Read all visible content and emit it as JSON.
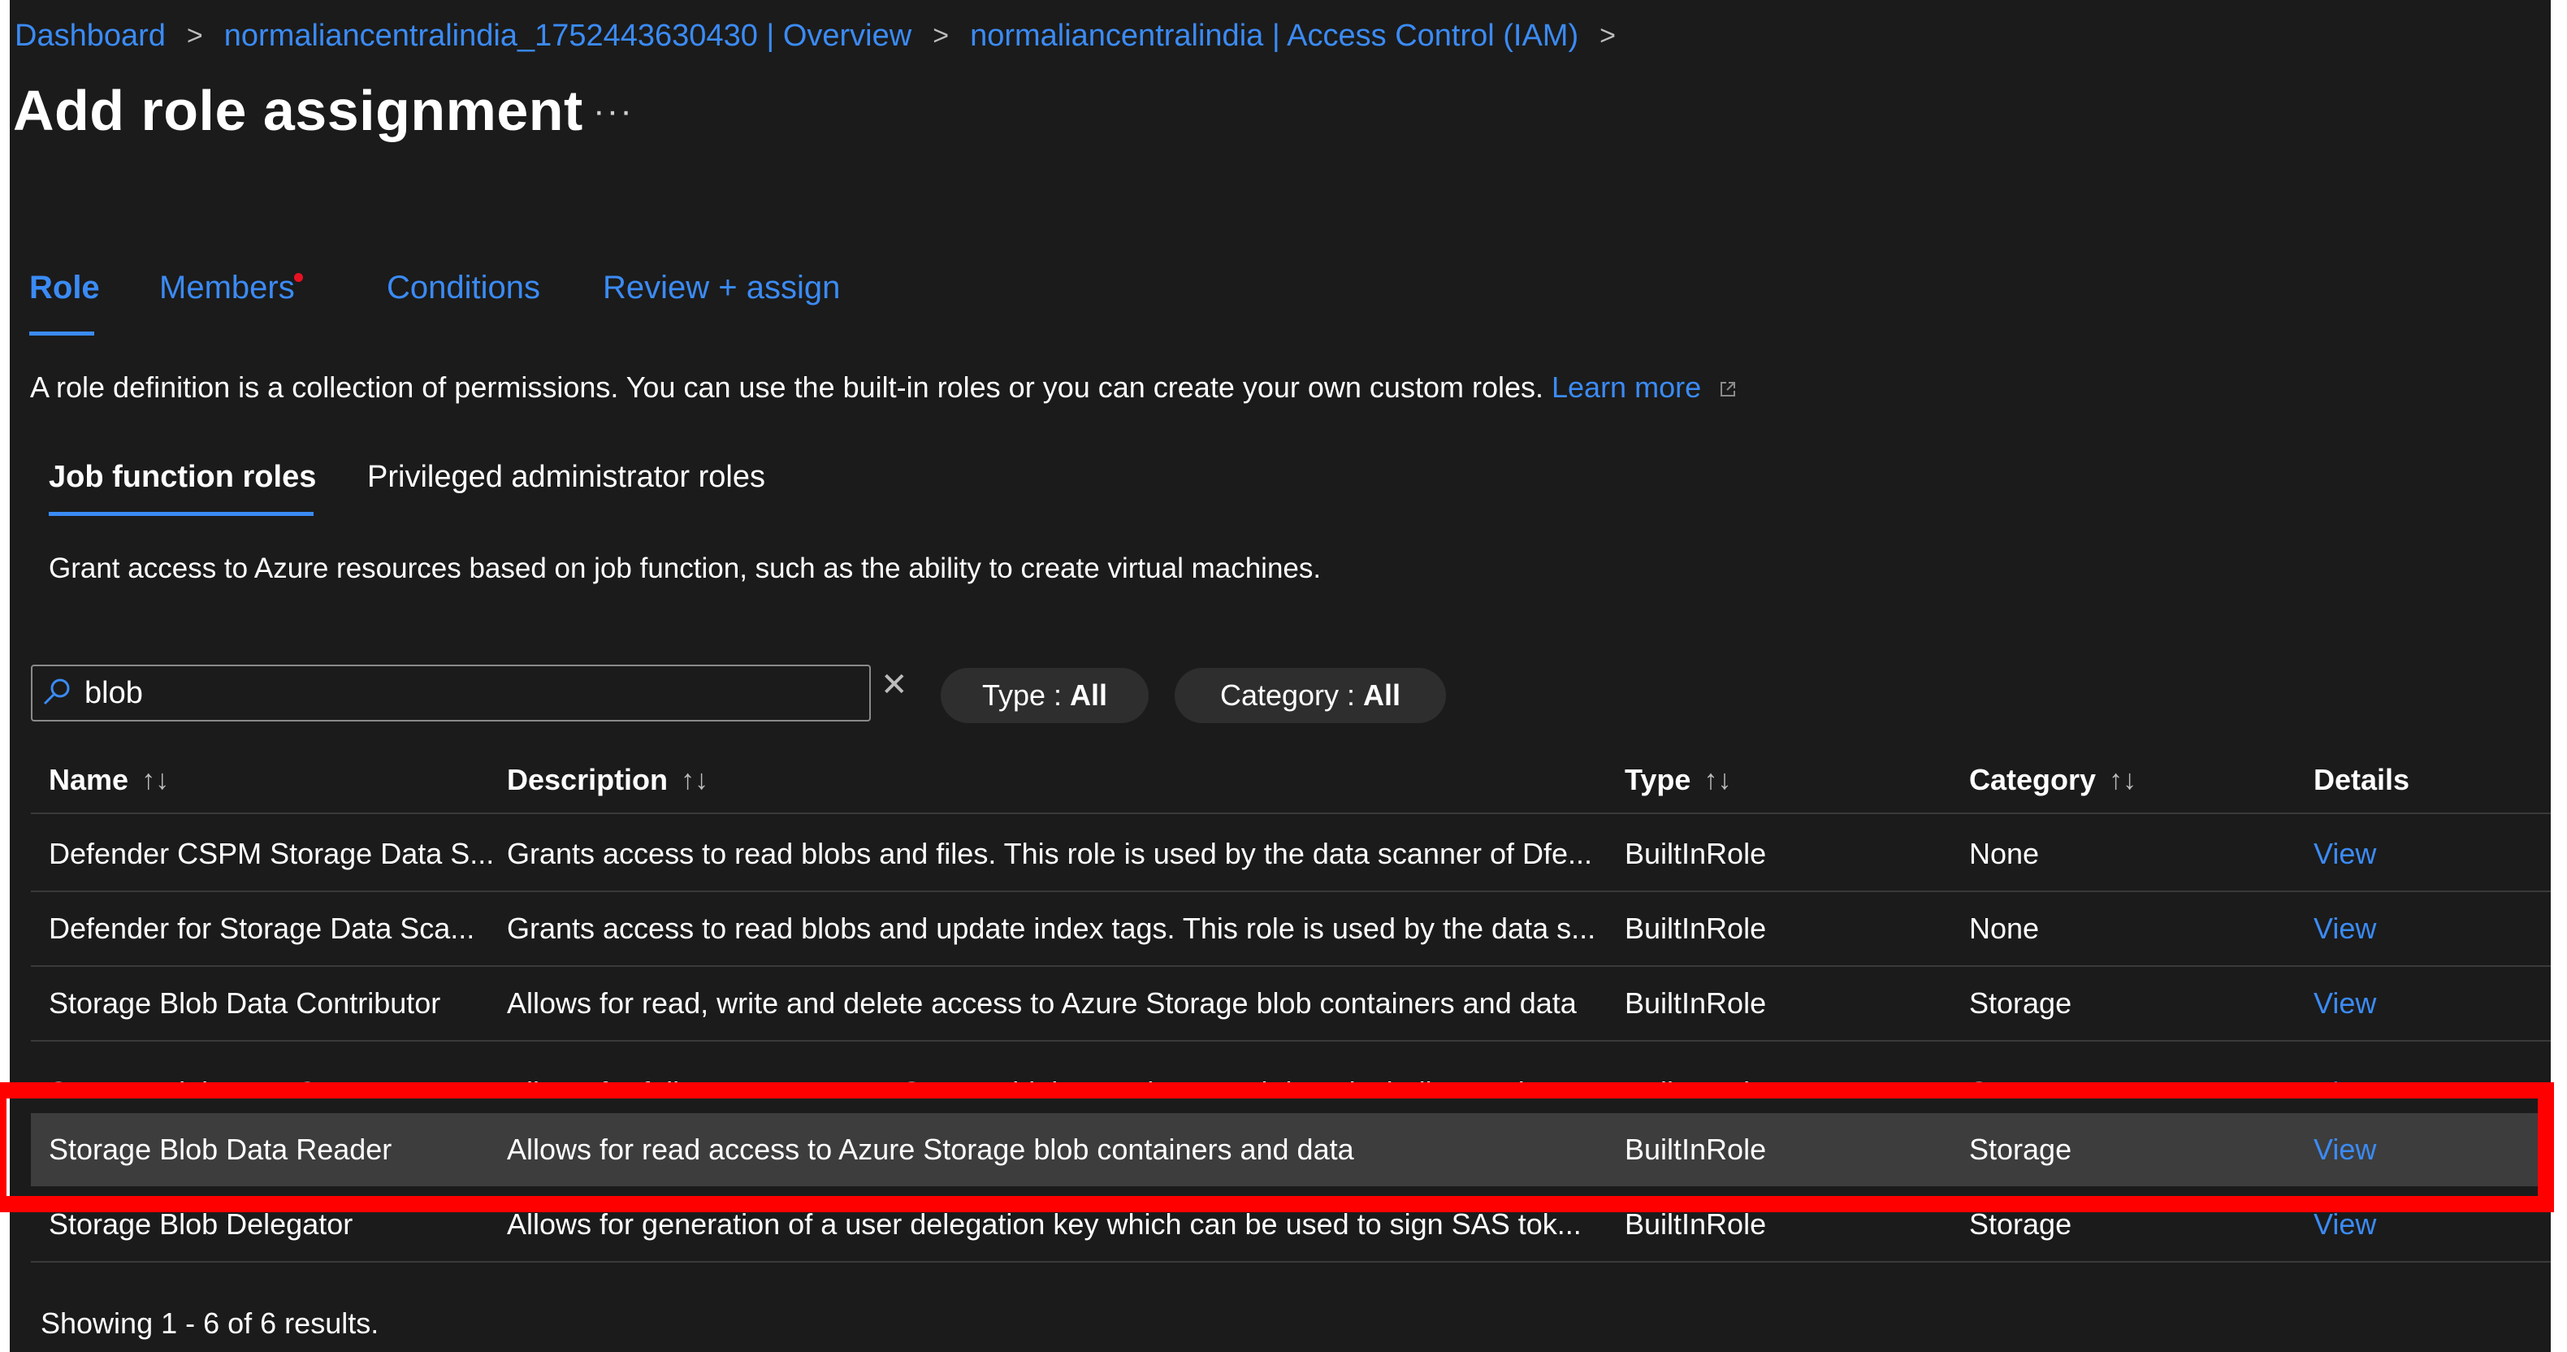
{
  "breadcrumb": [
    {
      "label": "Dashboard"
    },
    {
      "label": "normaliancentralindia_1752443630430 | Overview"
    },
    {
      "label": "normaliancentralindia | Access Control (IAM)"
    }
  ],
  "page": {
    "title": "Add role assignment",
    "more_label": "···"
  },
  "tabs": [
    {
      "label": "Role",
      "active": true
    },
    {
      "label": "Members",
      "has_indicator": true
    },
    {
      "label": "Conditions"
    },
    {
      "label": "Review + assign"
    }
  ],
  "intro": {
    "text": "A role definition is a collection of permissions. You can use the built-in roles or you can create your own custom roles.",
    "learn_more": "Learn more"
  },
  "role_tabs": [
    {
      "label": "Job function roles",
      "active": true
    },
    {
      "label": "Privileged administrator roles"
    }
  ],
  "role_tab_description": "Grant access to Azure resources based on job function, such as the ability to create virtual machines.",
  "search": {
    "value": "blob",
    "clear_label": "✕"
  },
  "filters": [
    {
      "label": "Type :",
      "value": "All"
    },
    {
      "label": "Category :",
      "value": "All"
    }
  ],
  "table": {
    "columns": [
      "Name",
      "Description",
      "Type",
      "Category",
      "Details"
    ],
    "rows": [
      {
        "name": "Defender CSPM Storage Data S...",
        "description": "Grants access to read blobs and files. This role is used by the data scanner of Dfe...",
        "type": "BuiltInRole",
        "category": "None",
        "details": "View"
      },
      {
        "name": "Defender for Storage Data Sca...",
        "description": "Grants access to read blobs and update index tags. This role is used by the data s...",
        "type": "BuiltInRole",
        "category": "None",
        "details": "View"
      },
      {
        "name": "Storage Blob Data Contributor",
        "description": "Allows for read, write and delete access to Azure Storage blob containers and data",
        "type": "BuiltInRole",
        "category": "Storage",
        "details": "View"
      },
      {
        "name": "Storage Blob Data Owner",
        "description": "Allows for full access to Azure Storage blob containers and data, including assign...",
        "type": "BuiltInRole",
        "category": "Storage",
        "details": "View"
      },
      {
        "name": "Storage Blob Data Reader",
        "description": "Allows for read access to Azure Storage blob containers and data",
        "type": "BuiltInRole",
        "category": "Storage",
        "details": "View",
        "selected": true
      },
      {
        "name": "Storage Blob Delegator",
        "description": "Allows for generation of a user delegation key which can be used to sign SAS tok...",
        "type": "BuiltInRole",
        "category": "Storage",
        "details": "View"
      }
    ]
  },
  "footer": {
    "results_text": "Showing 1 - 6 of 6 results."
  },
  "colors": {
    "background": "#1b1b1b",
    "accent": "#3b8bf5",
    "selected_row": "#3d3d3d",
    "highlight": "#ff0000",
    "indicator": "#e81123"
  }
}
